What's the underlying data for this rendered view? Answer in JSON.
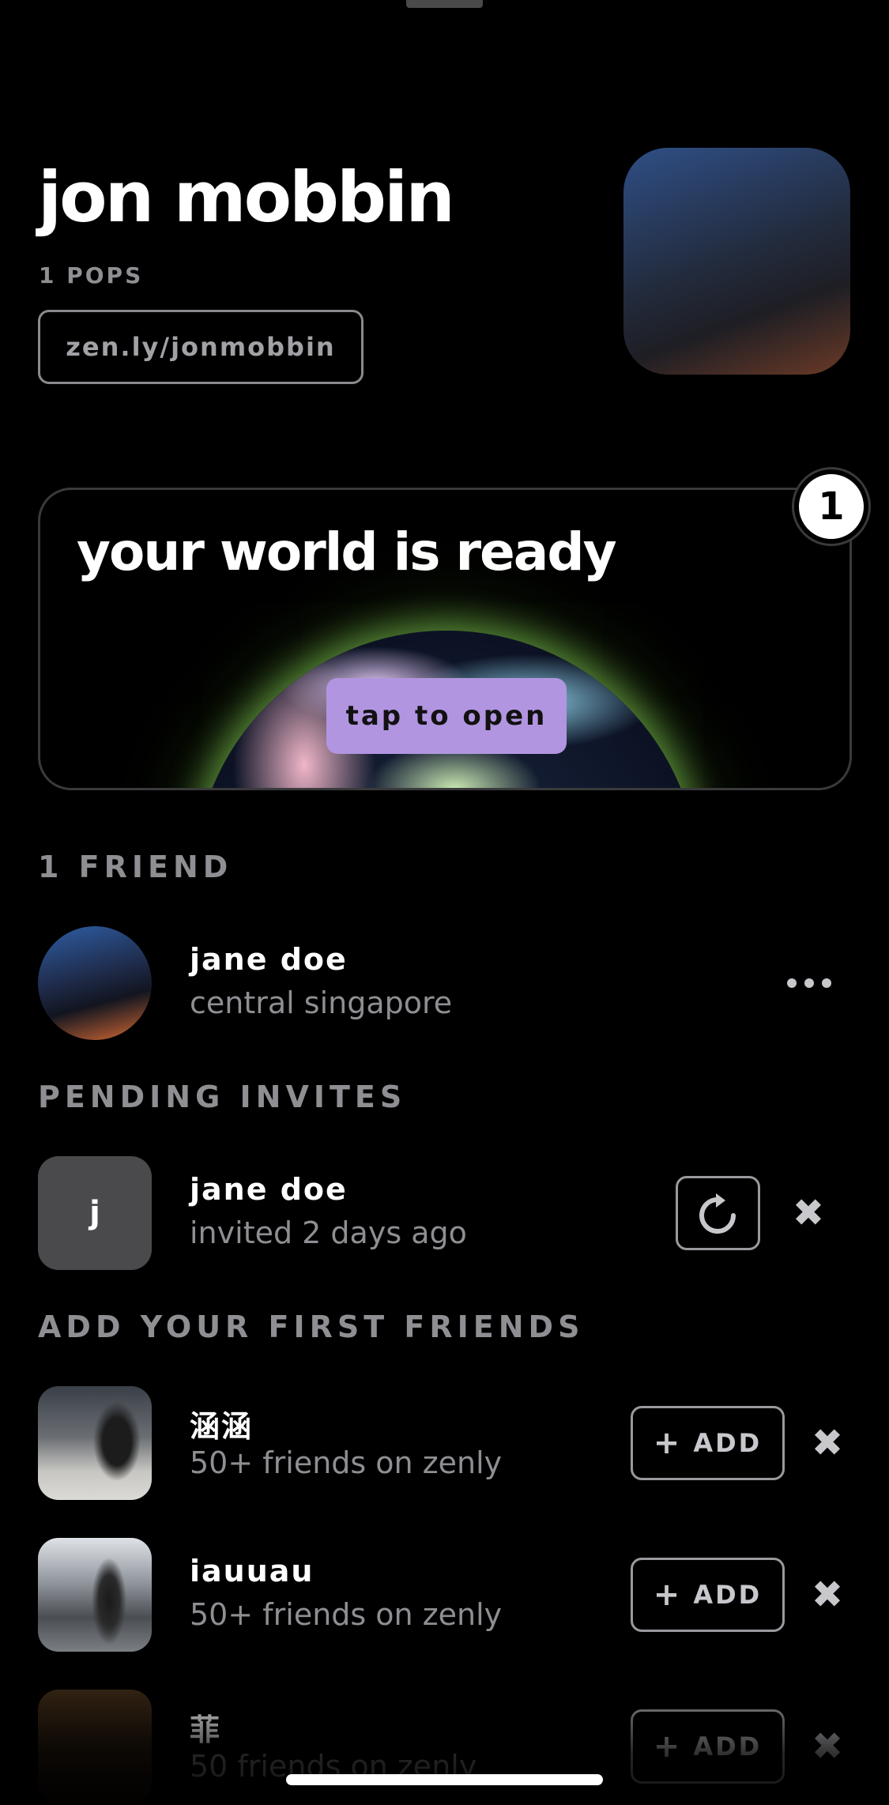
{
  "profile": {
    "name": "jon mobbin",
    "pops": "1 POPS",
    "link": "zen.ly/jonmobbin"
  },
  "world": {
    "title": "your world is ready",
    "open_label": "tap to open",
    "badge_count": "1"
  },
  "friends": {
    "header": "1 FRIEND",
    "items": [
      {
        "name": "jane doe",
        "subtitle": "central singapore"
      }
    ]
  },
  "pending": {
    "header": "PENDING INVITES",
    "items": [
      {
        "initial": "j",
        "name": "jane doe",
        "subtitle": "invited 2 days ago"
      }
    ]
  },
  "suggestions": {
    "header": "ADD YOUR FIRST FRIENDS",
    "add_label": "ADD",
    "items": [
      {
        "name": "涵涵",
        "subtitle": "50+ friends on zenly"
      },
      {
        "name": "iauuau",
        "subtitle": "50+ friends on zenly"
      },
      {
        "name": "菲",
        "subtitle": "50 friends on zenly"
      }
    ]
  },
  "icons": {
    "more": "ellipsis-icon",
    "resend": "refresh-icon",
    "dismiss": "close-icon",
    "add": "plus-icon"
  }
}
